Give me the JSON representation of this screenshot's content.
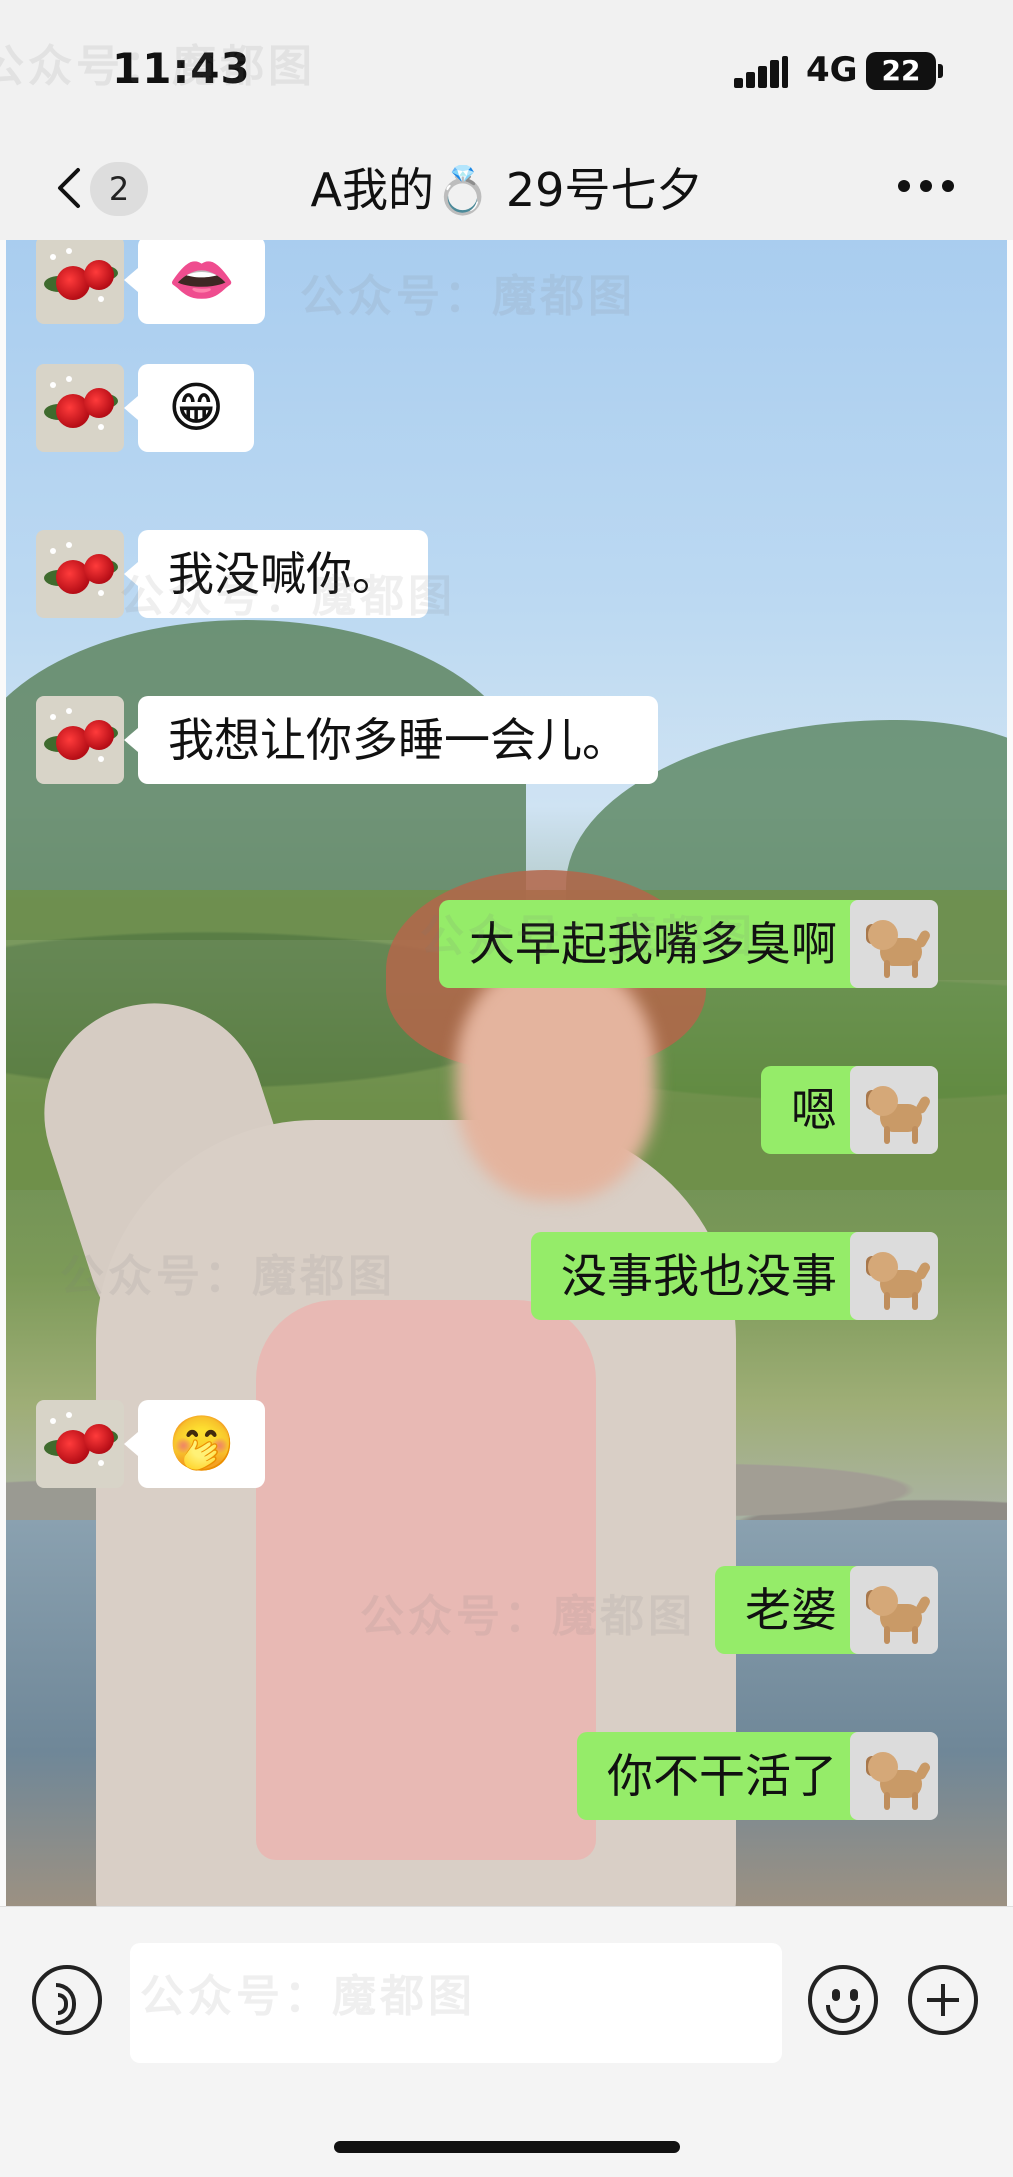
{
  "status_bar": {
    "time": "11:43",
    "network": "4G",
    "battery": "22"
  },
  "nav": {
    "unread_count": "2",
    "title": "A我的💍 29号七夕"
  },
  "messages": [
    {
      "side": "in",
      "text": "👄"
    },
    {
      "side": "in",
      "text": "😁"
    },
    {
      "side": "in",
      "text": "我没喊你。"
    },
    {
      "side": "in",
      "text": "我想让你多睡一会儿。"
    },
    {
      "side": "out",
      "text": "大早起我嘴多臭啊"
    },
    {
      "side": "out",
      "text": "嗯"
    },
    {
      "side": "out",
      "text": "没事我也没事"
    },
    {
      "side": "in",
      "text": "🤭"
    },
    {
      "side": "out",
      "text": "老婆"
    },
    {
      "side": "out",
      "text": "你不干活了"
    }
  ],
  "avatars": {
    "contact": "rose-bouquet-avatar",
    "self": "dog-avatar"
  },
  "input": {
    "placeholder": ""
  },
  "icons": {
    "voice": "voice-icon",
    "emoji": "emoji-icon",
    "more": "plus-icon",
    "back": "chevron-left-icon"
  },
  "colors": {
    "outgoing_bubble": "#95ec69",
    "incoming_bubble": "#ffffff",
    "bar_background": "#f1f1f1"
  },
  "watermark": "公众号：魔都图"
}
